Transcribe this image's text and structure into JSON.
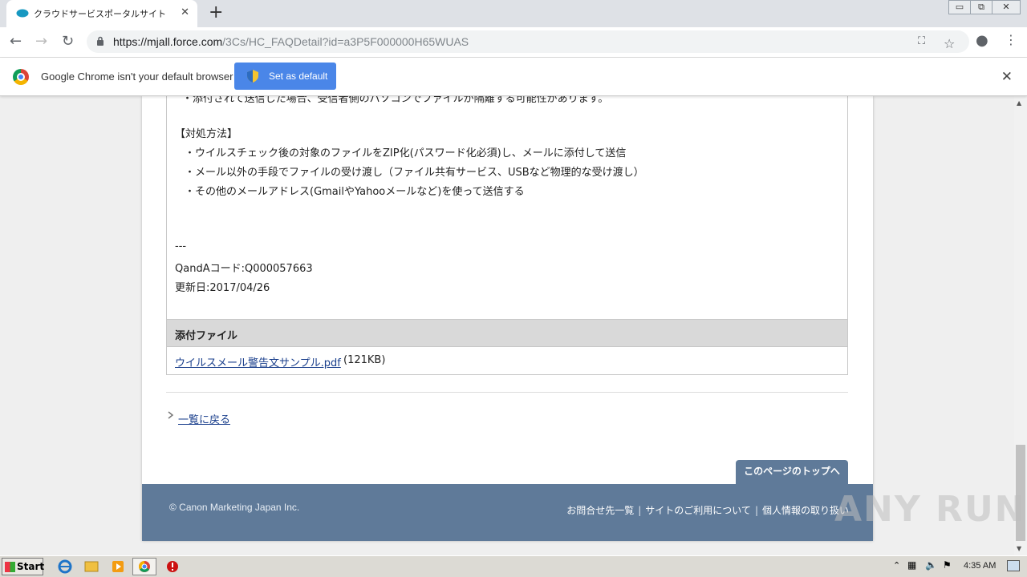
{
  "browser": {
    "tab_title": "クラウドサービスポータルサイト",
    "tab_close": "✕",
    "new_tab": "+",
    "url_host": "https://mjall.force.com",
    "url_path": "/3Cs/HC_FAQDetail?id=a3P5F000000H65WUAS",
    "window_controls": [
      "▭",
      "⧉",
      "✕"
    ]
  },
  "infobar": {
    "message": "Google Chrome isn't your default browser",
    "button_label": "Set as default",
    "close": "✕"
  },
  "article": {
    "cut_off_line": "・添付されて送信した場合、受信者側のパソコンでファイルが隔離する可能性があります。",
    "section_heading": "【対処方法】",
    "items": [
      "・ウイルスチェック後の対象のファイルをZIP化(パスワード化必須)し、メールに添付して送信",
      "・メール以外の手段でファイルの受け渡し（ファイル共有サービス、USBなど物理的な受け渡し）",
      "・その他のメールアドレス(GmailやYahooメールなど)を使って送信する"
    ],
    "separator": "---",
    "qa_code": "QandAコード:Q000057663",
    "updated": "更新日:2017/04/26"
  },
  "attachments": {
    "header": "添付ファイル",
    "file_name": "ウイルスメール警告文サンプル.pdf",
    "file_size": "(121KB)"
  },
  "nav": {
    "back_link": "一覧に戻る",
    "page_top": "このページのトップへ"
  },
  "footer": {
    "copyright": "© Canon Marketing Japan Inc.",
    "links": [
      "お問合せ先一覧",
      "サイトのご利用について",
      "個人情報の取り扱い"
    ]
  },
  "watermark": "ANY RUN",
  "taskbar": {
    "start_label": "Start",
    "clock": "4:35 AM"
  },
  "colors": {
    "footer_bg": "#5f7a99",
    "link": "#1a3f8c",
    "infobar_button": "#4a86e8"
  }
}
